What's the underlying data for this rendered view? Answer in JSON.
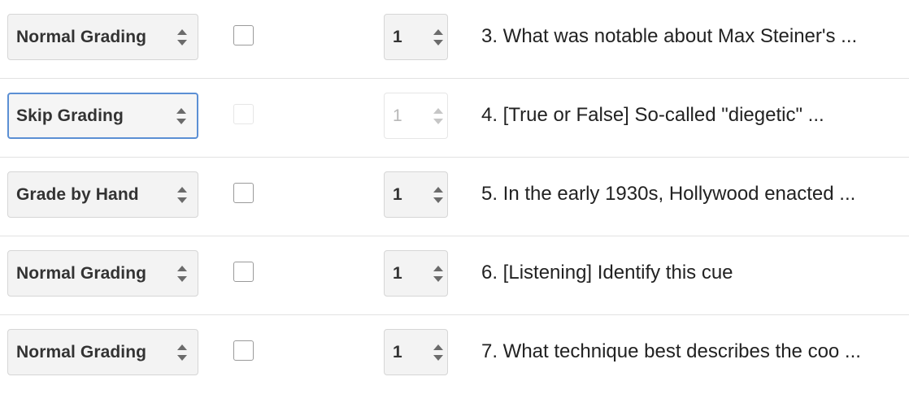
{
  "rows": [
    {
      "grading_mode": "Normal Grading",
      "checkbox_checked": false,
      "checkbox_disabled": false,
      "points": "1",
      "points_disabled": false,
      "question": "3. What was notable about Max Steiner's ..."
    },
    {
      "grading_mode": "Skip Grading",
      "checkbox_checked": false,
      "checkbox_disabled": true,
      "points": "1",
      "points_disabled": true,
      "question": "4. [True or False] So-called \"diegetic\" ..."
    },
    {
      "grading_mode": "Grade by Hand",
      "checkbox_checked": false,
      "checkbox_disabled": false,
      "points": "1",
      "points_disabled": false,
      "question": "5. In the early 1930s, Hollywood enacted ..."
    },
    {
      "grading_mode": "Normal Grading",
      "checkbox_checked": false,
      "checkbox_disabled": false,
      "points": "1",
      "points_disabled": false,
      "question": "6. [Listening] Identify this cue"
    },
    {
      "grading_mode": "Normal Grading",
      "checkbox_checked": false,
      "checkbox_disabled": false,
      "points": "1",
      "points_disabled": false,
      "question": "7. What technique best describes the coo ..."
    }
  ],
  "focused_row": 1,
  "icons": {
    "select_arrows": "up-down-arrows-icon"
  },
  "colors": {
    "focus_border": "#5b8fd4",
    "select_bg": "#f3f3f3",
    "divider": "#e2e2e2"
  }
}
